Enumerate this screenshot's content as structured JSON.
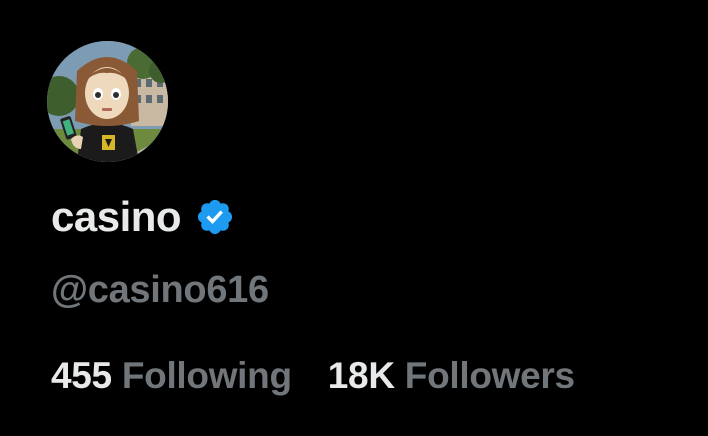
{
  "profile": {
    "display_name": "casino",
    "handle": "@casino616",
    "verified": true,
    "avatar_icon": "cartoon-avatar"
  },
  "stats": {
    "following_count": "455",
    "following_label": "Following",
    "followers_count": "18K",
    "followers_label": "Followers"
  },
  "colors": {
    "background": "#000000",
    "primary_text": "#e7e9ea",
    "secondary_text": "#71767b",
    "verified_badge": "#1d9bf0"
  }
}
